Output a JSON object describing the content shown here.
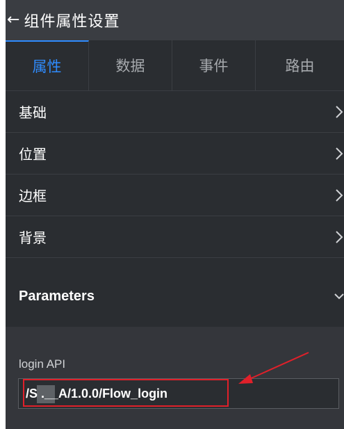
{
  "header": {
    "back_icon": "arrow-left-icon",
    "title": "组件属性设置"
  },
  "tabs": [
    {
      "label": "属性",
      "active": true
    },
    {
      "label": "数据",
      "active": false
    },
    {
      "label": "事件",
      "active": false
    },
    {
      "label": "路由",
      "active": false
    }
  ],
  "rows": [
    {
      "label": "基础",
      "icon": "chevron-right-icon"
    },
    {
      "label": "位置",
      "icon": "chevron-right-icon"
    },
    {
      "label": "边框",
      "icon": "chevron-right-icon"
    },
    {
      "label": "背景",
      "icon": "chevron-right-icon"
    },
    {
      "label": "Parameters",
      "icon": "chevron-down-icon"
    }
  ],
  "parameters": {
    "field_label": "login API",
    "field_value": "/S  .__A/1.0.0/Flow_login"
  },
  "colors": {
    "accent": "#2f8cff",
    "annotation": "#e0202a"
  }
}
